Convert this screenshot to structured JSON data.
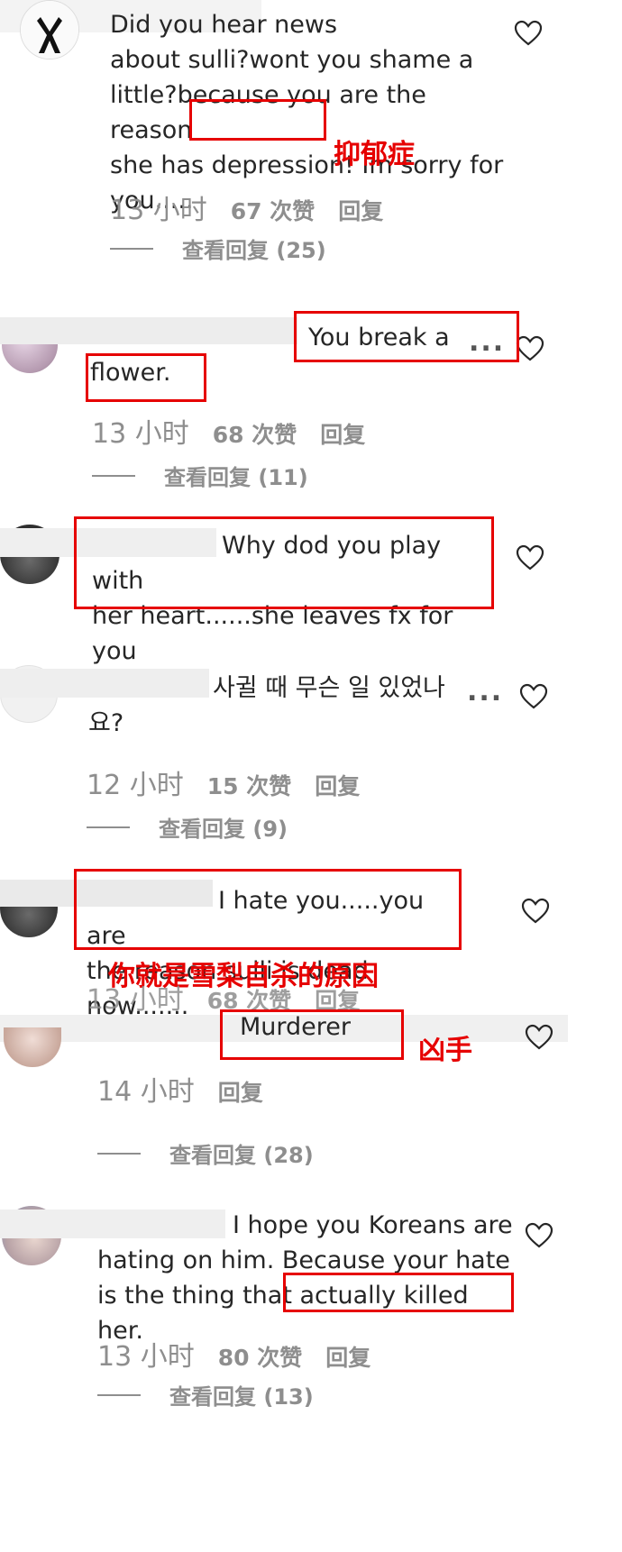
{
  "comments": [
    {
      "text": "Did you hear news\nabout sulli?wont you shame a\nlittle?because you are the reason\nshe has depression! Im sorry for\nyou.....",
      "time": "13 小时",
      "likes": "67 次赞",
      "reply": "回复",
      "view_replies": "查看回复 (25)",
      "note": "抑郁症"
    },
    {
      "text": "You break a\nflower.",
      "time": "13 小时",
      "likes": "68 次赞",
      "reply": "回复",
      "view_replies": "查看回复 (11)"
    },
    {
      "text": "Why dod you play with\nher heart......she leaves fx for you\n.....",
      "time": "",
      "likes": "",
      "reply": ""
    },
    {
      "text": "사귈 때 무슨 일 있었나\n요?",
      "time": "12 小时",
      "likes": "15 次赞",
      "reply": "回复",
      "view_replies": "查看回复 (9)"
    },
    {
      "text": "I hate you.....you are\nthe reason sulli is dead now.......",
      "time": "13 小时",
      "likes": "68 次赞",
      "reply": "回复",
      "note": "你就是雪梨自杀的原因"
    },
    {
      "text": "Murderer",
      "time": "14 小时",
      "reply": "回复",
      "view_replies": "查看回复 (28)",
      "note": "凶手"
    },
    {
      "text": "I hope you Koreans are\nhating on him. Because your hate\nis the thing that actually killed her.",
      "time": "13 小时",
      "likes": "80 次赞",
      "reply": "回复",
      "view_replies": "查看回复 (13)"
    }
  ],
  "more_label": "...",
  "colors": {
    "accent_red": "#e60000",
    "meta_gray": "#8e8e8e"
  },
  "icons": [
    "heart-icon",
    "more-icon",
    "avatar"
  ]
}
